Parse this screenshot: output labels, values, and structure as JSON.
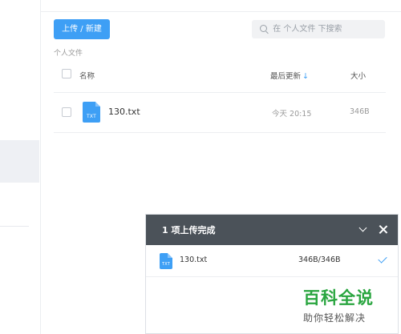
{
  "toolbar": {
    "upload_label": "上传 / 新建"
  },
  "search": {
    "placeholder": "在 个人文件 下搜索"
  },
  "breadcrumb": "个人文件",
  "table": {
    "headers": {
      "name": "名称",
      "date": "最后更新",
      "size": "大小"
    },
    "sort_arrow": "↓",
    "rows": [
      {
        "name": "130.txt",
        "ext": "TXT",
        "date": "今天 20:15",
        "size": "346B"
      }
    ]
  },
  "upload_panel": {
    "title": "1 项上传完成",
    "items": [
      {
        "name": "130.txt",
        "ext": "TXT",
        "progress": "346B/346B",
        "status": "done"
      }
    ]
  },
  "watermark": {
    "title": "百科全说",
    "subtitle": "助你轻松解决"
  },
  "colors": {
    "accent": "#3e9ff5",
    "panel_header": "#4b5259",
    "watermark_green": "#29a53f"
  }
}
